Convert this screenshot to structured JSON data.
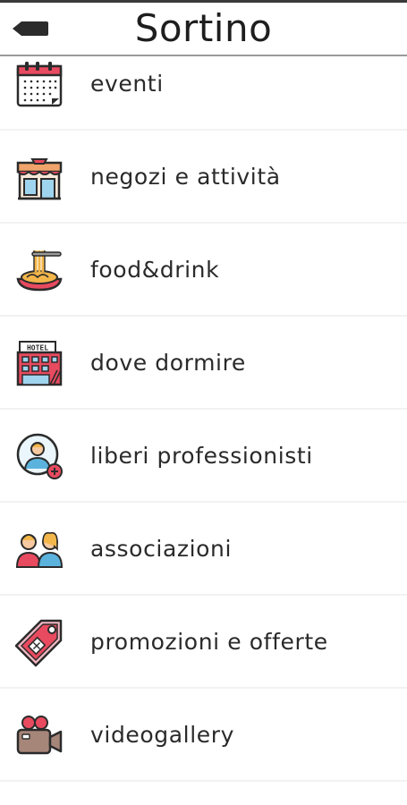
{
  "header": {
    "title": "Sortino",
    "back_icon": "back-arrow-icon"
  },
  "menu": {
    "items": [
      {
        "label": "eventi",
        "icon": "calendar-icon"
      },
      {
        "label": "negozi e attività",
        "icon": "shop-icon"
      },
      {
        "label": "food&drink",
        "icon": "spaghetti-icon"
      },
      {
        "label": "dove dormire",
        "icon": "hotel-icon"
      },
      {
        "label": "liberi professionisti",
        "icon": "professional-icon"
      },
      {
        "label": "associazioni",
        "icon": "people-icon"
      },
      {
        "label": "promozioni e offerte",
        "icon": "price-tag-icon"
      },
      {
        "label": "videogallery",
        "icon": "video-camera-icon"
      }
    ]
  },
  "colors": {
    "text": "#2a2a2a",
    "divider": "#f2f2f2",
    "header_border": "#9a9a9a",
    "icon_red": "#e84a5f",
    "icon_dark": "#2b2b2b"
  }
}
